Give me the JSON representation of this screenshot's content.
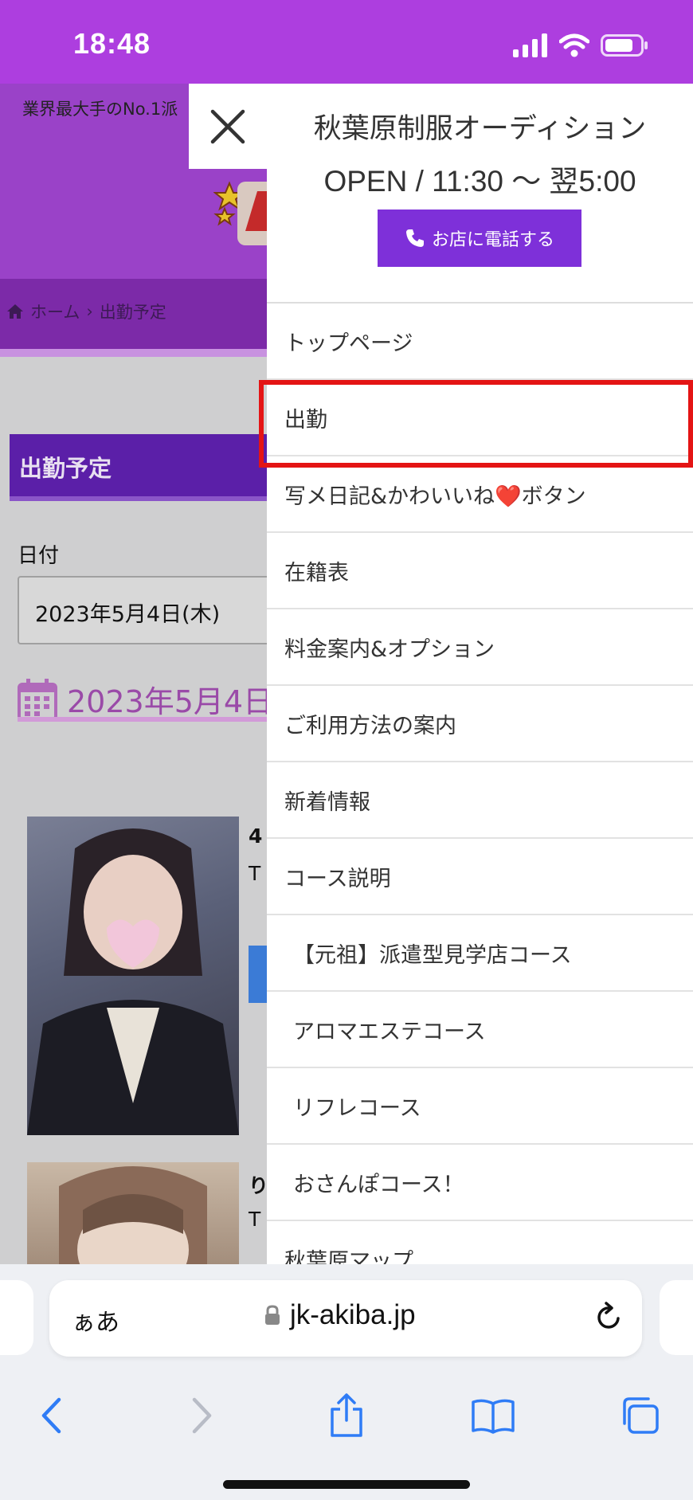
{
  "status": {
    "time": "18:48"
  },
  "background": {
    "tagline": "業界最大手のNo.1派",
    "breadcrumb": {
      "home": "ホーム",
      "current": "出勤予定"
    },
    "section_title": "出勤予定",
    "date_label": "日付",
    "date_value": "2023年5月4日(木)",
    "date_heading": "2023年5月4日",
    "cards": [
      {
        "initial": "4",
        "line1": "T"
      },
      {
        "initial": "り",
        "line1": "T"
      }
    ]
  },
  "drawer": {
    "shop_name": "秋葉原制服オーディション",
    "hours": "OPEN / 11:30 〜 翌5:00",
    "call_label": "お店に電話する",
    "menu": [
      {
        "label": "トップページ",
        "sub": false
      },
      {
        "label": "出勤",
        "sub": false
      },
      {
        "label": "写メ日記&かわいいね❤️ボタン",
        "sub": false
      },
      {
        "label": "在籍表",
        "sub": false
      },
      {
        "label": "料金案内&オプション",
        "sub": false
      },
      {
        "label": "ご利用方法の案内",
        "sub": false
      },
      {
        "label": "新着情報",
        "sub": false
      },
      {
        "label": "コース説明",
        "sub": false
      },
      {
        "label": "【元祖】派遣型見学店コース",
        "sub": true
      },
      {
        "label": "アロマエステコース",
        "sub": true
      },
      {
        "label": "リフレコース",
        "sub": true
      },
      {
        "label": "おさんぽコース！",
        "sub": true
      },
      {
        "label": "秋葉原マップ",
        "sub": false
      }
    ],
    "highlighted_index": 1
  },
  "browser": {
    "aa_label": "ぁあ",
    "url": "jk-akiba.jp"
  },
  "colors": {
    "status_bar": "#ad3edf",
    "call_button": "#7e30d9",
    "highlight": "#e41414",
    "toolbar_icon": "#2f7cf6"
  },
  "icons": [
    "close-icon",
    "phone-icon",
    "lock-icon",
    "reload-icon",
    "back-icon",
    "forward-icon",
    "share-icon",
    "bookmarks-icon",
    "tabs-icon",
    "calendar-icon",
    "home-icon"
  ]
}
